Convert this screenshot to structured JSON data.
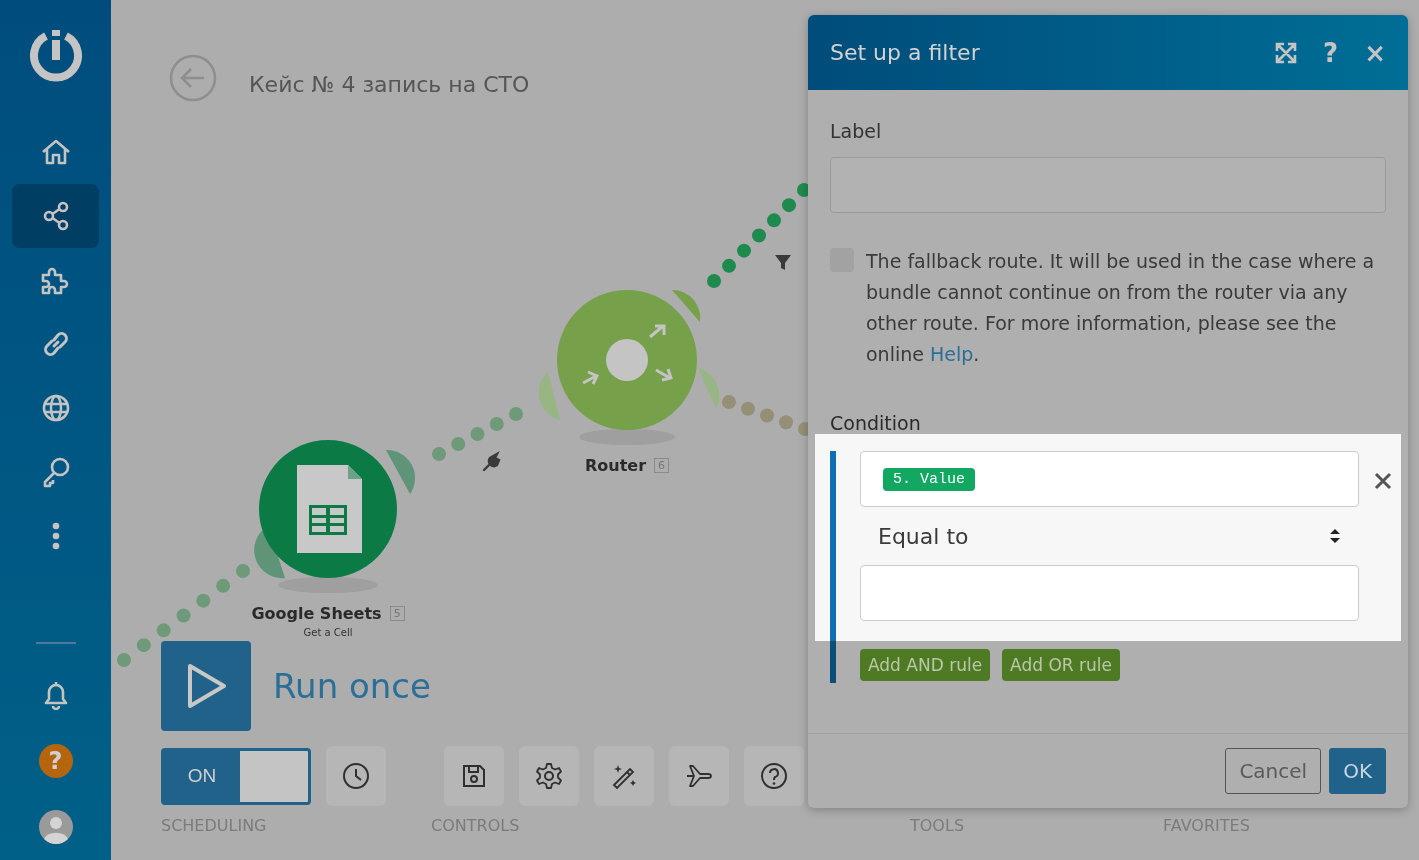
{
  "sidebar": {
    "items": [
      {
        "kind": "home",
        "selected": false
      },
      {
        "kind": "share",
        "selected": true
      },
      {
        "kind": "puzzle",
        "selected": false
      },
      {
        "kind": "link",
        "selected": false
      },
      {
        "kind": "globe",
        "selected": false
      },
      {
        "kind": "key",
        "selected": false
      },
      {
        "kind": "more",
        "selected": false
      }
    ],
    "bottom": [
      {
        "kind": "bell"
      },
      {
        "kind": "help",
        "glyph": "?"
      },
      {
        "kind": "avatar"
      }
    ]
  },
  "scenario": {
    "title": "Кейс № 4 запись на СТО",
    "nodes": [
      {
        "kind": "sheets",
        "name": "Google Sheets",
        "badge": "5",
        "subtitle": "Get a Cell"
      },
      {
        "kind": "router",
        "name": "Router",
        "badge": "6"
      }
    ]
  },
  "toolbar": {
    "run": {
      "label": "Run once"
    },
    "scheduling": {
      "label": "ON",
      "on": true
    },
    "controls": [
      {
        "kind": "save"
      },
      {
        "kind": "settings"
      },
      {
        "kind": "magic"
      },
      {
        "kind": "airplane"
      },
      {
        "kind": "help"
      }
    ],
    "sections": [
      "SCHEDULING",
      "CONTROLS",
      "TOOLS",
      "FAVORITES"
    ]
  },
  "dialog": {
    "title": "Set up a filter",
    "actions": [
      {
        "kind": "expand"
      },
      {
        "kind": "help",
        "glyph": "?"
      },
      {
        "kind": "close",
        "glyph": "×"
      }
    ],
    "label_field": {
      "label": "Label"
    },
    "fallback": {
      "checked": false,
      "text": "The fallback route. It will be used in the case where a bundle cannot continue on from the router via any other route. For more information, please see the online",
      "link": "Help",
      "tail": "."
    },
    "condition": {
      "label": "Condition",
      "token": "5. Value",
      "operator": "Equal to",
      "buttons": [
        "Add AND rule",
        "Add OR rule"
      ]
    },
    "footer": {
      "buttons": [
        {
          "kind": "secondary",
          "label": "Cancel"
        },
        {
          "kind": "primary",
          "label": "OK"
        }
      ]
    }
  }
}
